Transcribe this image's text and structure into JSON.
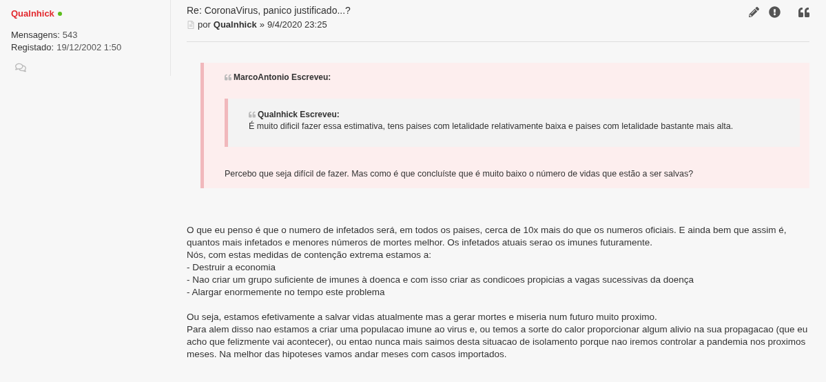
{
  "author": {
    "name": "Qualnhick",
    "online": true,
    "stats": [
      {
        "label": "Mensagens:",
        "value": "543"
      },
      {
        "label": "Registado:",
        "value": "19/12/2002 1:50"
      }
    ]
  },
  "post": {
    "title": "Re: CoronaVirus, panico justificado...?",
    "by": "por",
    "author": "Qualnhick",
    "separator": "»",
    "date": "9/4/2020 23:25"
  },
  "quote": {
    "header": "MarcoAntonio Escreveu:",
    "nested": {
      "header": "Qualnhick Escreveu:",
      "text": "É muito dificil fazer essa estimativa, tens paises com letalidade relativamente baixa e paises com letalidade bastante mais alta."
    },
    "text": "Percebo que seja difícil de fazer. Mas como é que concluíste que é muito baixo o número de vidas que estão a ser salvas?"
  },
  "body": [
    [
      "O que eu penso é que o numero de infetados será, em todos os paises, cerca de 10x mais do que os numeros oficiais. E ainda bem que assim é, quantos mais infetados e menores números de mortes melhor. Os infetados atuais serao os imunes futuramente.",
      "Nós, com estas medidas de contenção extrema estamos a:",
      "- Destruir a economia",
      "- Nao criar um grupo suficiente de imunes à doenca e com isso criar as condicoes propicias a vagas sucessivas da doença",
      "- Alargar enormemente no tempo este problema"
    ],
    [
      "Ou seja, estamos efetivamente a salvar vidas atualmente mas a gerar mortes e miseria num futuro muito proximo.",
      "Para alem disso nao estamos a criar uma populacao imune ao virus e, ou temos a sorte do calor proporcionar algum alivio na sua propagacao (que eu acho que felizmente vai acontecer), ou entao nunca mais saimos desta situacao de isolamento porque nao iremos controlar a pandemia nos proximos meses. Na melhor das hipoteses vamos andar meses com casos importados."
    ]
  ]
}
